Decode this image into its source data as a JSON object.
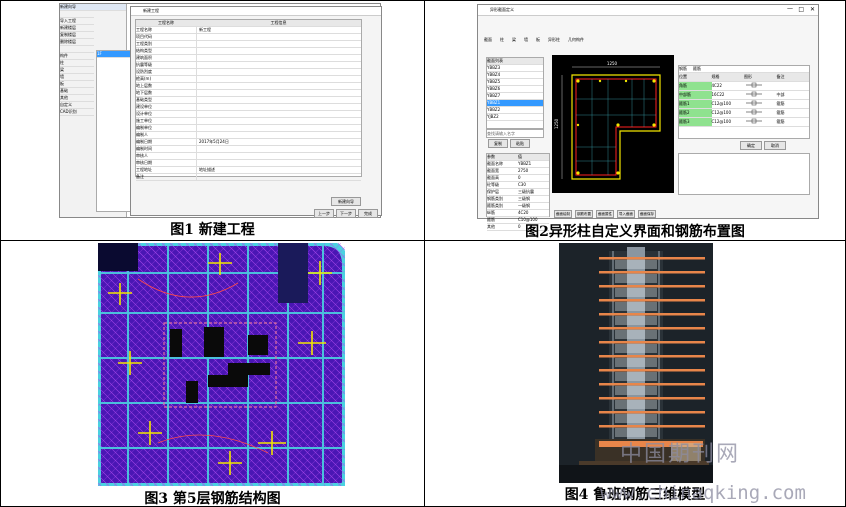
{
  "figures": {
    "fig1": {
      "caption": "图1  新建工程",
      "dialog_title": "新建工程",
      "header_cols": [
        "工程名称",
        "工程信息"
      ],
      "field_labels": [
        "工程名称",
        "项目代码",
        "工程类别",
        "结构类型",
        "建筑面积",
        "抗震等级",
        "设防烈度",
        "檐高(m)",
        "地上层数",
        "地下层数",
        "基础类型",
        "建设单位",
        "设计单位",
        "施工单位",
        "编制单位",
        "编制人",
        "编制日期",
        "编制时间",
        "审核人",
        "审核日期",
        "工程地址",
        "备注"
      ],
      "field_values": [
        "新工程",
        "",
        "",
        "",
        "",
        "",
        "",
        "",
        "",
        "",
        "",
        "",
        "",
        "",
        "",
        "",
        "2017年5月24日",
        "",
        "",
        "",
        "地址描述",
        ""
      ],
      "left_labels": [
        "新建向导",
        "",
        "导入工程",
        "新建楼层",
        "复制楼层",
        "删除楼层",
        "",
        "构件",
        "柱",
        "梁",
        "墙",
        "板",
        "基础",
        "其他",
        "自定义",
        "CAD识别"
      ],
      "buttons": [
        "上一步",
        "下一步",
        "完成"
      ],
      "side_button": "选择文件",
      "bottom_button": "新建向导"
    },
    "fig2": {
      "caption": "图2异形柱自定义界面和钢筋布置图",
      "window_title": "异形截面定义",
      "tabs": [
        "截面",
        "柱",
        "梁",
        "墙",
        "板",
        "异形柱",
        "几何构件"
      ],
      "list_header": "截面列表",
      "list_items": [
        "YBBZ3",
        "YBBZ4",
        "YBBZ5",
        "YBBZ6",
        "YBBZ7",
        "YBBZ1",
        "YBBZ2",
        "YJBZ2"
      ],
      "selected_item": "YBBZ1",
      "search_placeholder": "查找请输入名字",
      "list_buttons": [
        "复制",
        "粘贴"
      ],
      "prop_rows": [
        [
          "参数",
          "值"
        ],
        [
          "截面名称",
          "YBBZ1"
        ],
        [
          "截面宽",
          "2750"
        ],
        [
          "截面高",
          "0"
        ],
        [
          "砼等级",
          "C30"
        ],
        [
          "保护层",
          "三级抗震"
        ],
        [
          "钢筋类别",
          "三级钢"
        ],
        [
          "箍筋类别",
          "一级钢"
        ],
        [
          "纵筋",
          "4C20"
        ],
        [
          "箍筋",
          "C10@100"
        ],
        [
          "其他",
          "0"
        ]
      ],
      "right_tabs": [
        "钢筋",
        "箍筋"
      ],
      "rebar_rows": [
        [
          "位置",
          "规格",
          "图形",
          "备注"
        ],
        [
          "角筋",
          "4C22",
          "",
          ""
        ],
        [
          "中部筋",
          "16C22",
          "",
          "中部"
        ],
        [
          "箍筋1",
          "C12@100",
          "",
          "箍筋"
        ],
        [
          "箍筋2",
          "C12@100",
          "",
          "箍筋"
        ],
        [
          "箍筋3",
          "C12@100",
          "",
          "箍筋"
        ]
      ],
      "bottom_buttons": [
        "截面绘制",
        "钢筋布置",
        "截面属性",
        "导入截面",
        "截面保存"
      ],
      "right_buttons": [
        "确定",
        "取消"
      ],
      "dims": [
        "1250",
        "1250"
      ]
    },
    "fig3": {
      "caption": "图3  第5层钢筋结构图"
    },
    "fig4": {
      "caption": "图4  鲁班钢筋三维模型"
    }
  },
  "watermark": {
    "cn": "中国期刊网",
    "url": "www.chinaqking.com"
  },
  "colors": {
    "cad_bg": "#000000",
    "rebar_red": "#ff2020",
    "rebar_yellow": "#f2e600",
    "slab_purple": "#5a1ec8",
    "wall_cyan": "#4ad2e0",
    "building_orange": "#e8864a",
    "selected_blue": "#3399ff"
  }
}
